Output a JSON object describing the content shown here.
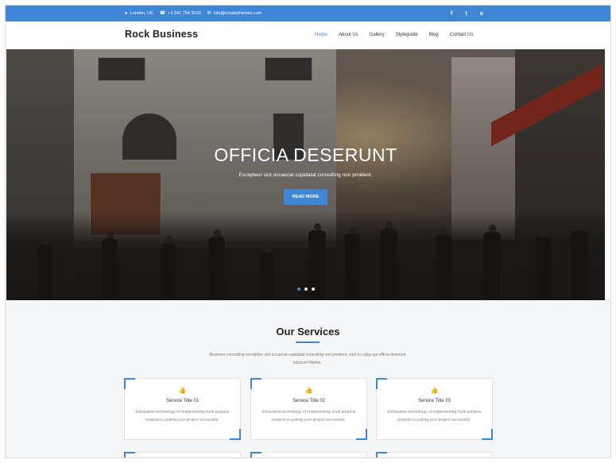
{
  "topbar": {
    "location": "London, UK",
    "phone": "+1 541 754 3010",
    "email": "info@creativthemes.com",
    "social": [
      "f",
      "t",
      "o"
    ],
    "accent": "#3f86d6"
  },
  "header": {
    "brand": "Rock Business",
    "nav": [
      "Home",
      "About Us",
      "Gallery",
      "Styleguide",
      "Blog",
      "Contact Us"
    ],
    "active": "Home"
  },
  "hero": {
    "title": "OFFICIA DESERUNT",
    "subtitle": "Excepteur sint occaecat cupidatat consulting non proident.",
    "button": "READ MORE",
    "slides": 3,
    "active_slide": 1
  },
  "services": {
    "title": "Our Services",
    "intro": "Business consulting excepteur sint occaecat cupidatat consulting non proident, sunt in culpa qui officia deserunt laborum Market.",
    "cards": [
      {
        "icon": "thumbs-up-icon",
        "title": "Service Title 01",
        "desc": "Exhaustive technology of implementing multi purpose projects is putting your project successful."
      },
      {
        "icon": "thumbs-up-icon",
        "title": "Service Title 02",
        "desc": "Exhaustive technology of implementing multi purpose projects is putting your project successful."
      },
      {
        "icon": "thumbs-up-icon",
        "title": "Service Title 03",
        "desc": "Exhaustive technology of implementing multi purpose projects is putting your project successful."
      }
    ]
  }
}
